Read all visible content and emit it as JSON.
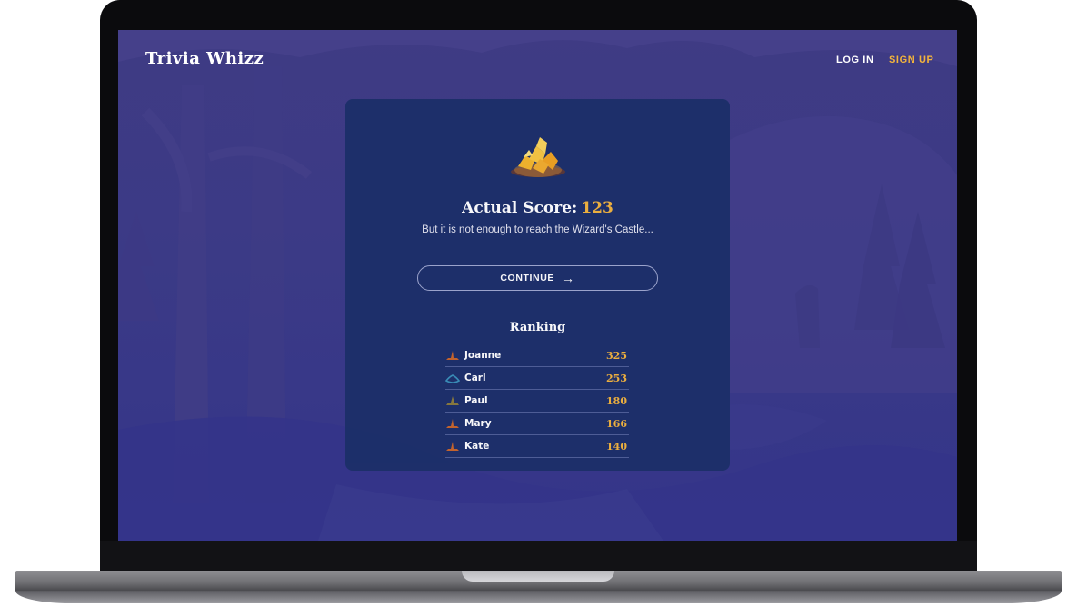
{
  "header": {
    "logo": "Trivia Whizz",
    "login_label": "LOG IN",
    "signup_label": "SIGN UP"
  },
  "result": {
    "score_label": "Actual Score:",
    "score_value": "123",
    "message": "But it is not enough to reach the Wizard's Castle...",
    "continue_label": "CONTINUE",
    "continue_icon": "arrow-right-icon",
    "reward_icon": "gold-pile-icon"
  },
  "ranking": {
    "title": "Ranking",
    "rows": [
      {
        "name": "Joanne",
        "score": "325",
        "icon": "hat-icon",
        "color": "#c9652a"
      },
      {
        "name": "Carl",
        "score": "253",
        "icon": "hat-icon",
        "color": "#3a8fb8"
      },
      {
        "name": "Paul",
        "score": "180",
        "icon": "hat-icon",
        "color": "#8a7a3c"
      },
      {
        "name": "Mary",
        "score": "166",
        "icon": "hat-icon",
        "color": "#c9652a"
      },
      {
        "name": "Kate",
        "score": "140",
        "icon": "hat-icon",
        "color": "#c9652a"
      }
    ]
  },
  "colors": {
    "accent": "#f2b33d",
    "card": "#1c2f69",
    "background": "#3b3a86"
  }
}
